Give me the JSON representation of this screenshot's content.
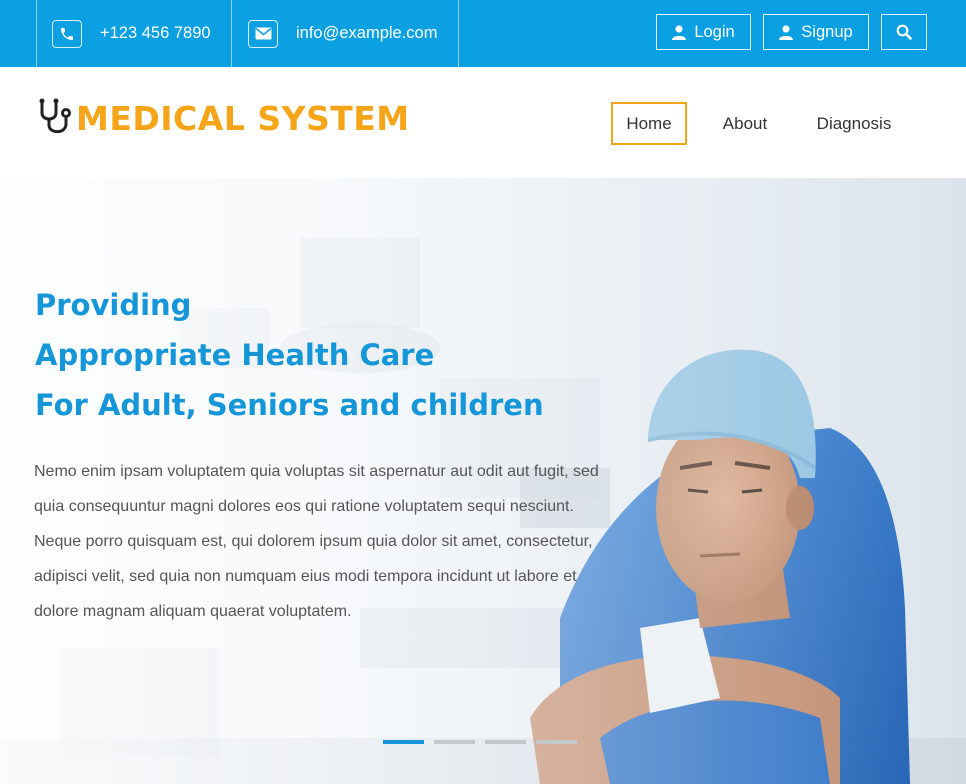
{
  "topbar": {
    "phone": "+123 456 7890",
    "email": "info@example.com",
    "login_label": "Login",
    "signup_label": "Signup"
  },
  "brand": {
    "name": "MEDICAL SYSTEM",
    "logo_icon": "stethoscope-icon"
  },
  "nav": {
    "items": [
      {
        "label": "Home",
        "active": true
      },
      {
        "label": "About",
        "active": false
      },
      {
        "label": "Diagnosis",
        "active": false
      }
    ]
  },
  "hero": {
    "headline": [
      "Providing",
      "Appropriate Health Care",
      "For Adult, Seniors and children"
    ],
    "description": "Nemo enim ipsam voluptatem quia voluptas sit aspernatur aut odit aut fugit, sed quia consequuntur magni dolores eos qui ratione voluptatem sequi nesciunt. Neque porro quisquam est, qui dolorem ipsum quia dolor sit amet, consectetur, adipisci velit, sed quia non numquam eius modi tempora incidunt ut labore et dolore magnam aliquam quaerat voluptatem.",
    "slides_total": 4,
    "active_slide": 1
  },
  "colors": {
    "topbar": "#0aa0e1",
    "brand_orange": "#f6a418",
    "headline_blue": "#1596d8",
    "scrubs_blue": "#2a6fc4"
  }
}
